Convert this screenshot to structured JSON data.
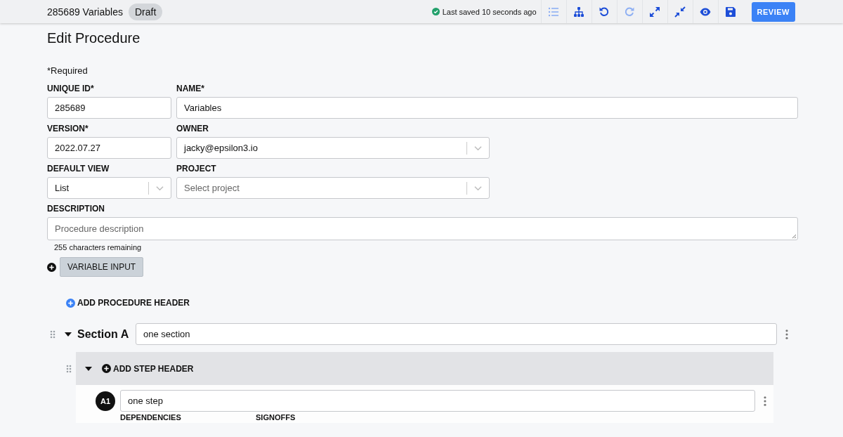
{
  "header": {
    "title": "285689 Variables",
    "status": "Draft",
    "save_status": "Last saved 10 seconds ago",
    "tools": [
      {
        "kind": "list",
        "disabled": true
      },
      {
        "kind": "tree",
        "disabled": false
      },
      {
        "kind": "undo",
        "disabled": false
      },
      {
        "kind": "redo",
        "disabled": true
      },
      {
        "kind": "expand",
        "disabled": false
      },
      {
        "kind": "collapse",
        "disabled": false
      },
      {
        "kind": "eye",
        "disabled": false
      },
      {
        "kind": "save",
        "disabled": false
      }
    ],
    "review": "REVIEW"
  },
  "page_title": "Edit Procedure",
  "required_note": "*Required",
  "fields": [
    {
      "label": "UNIQUE ID*",
      "kind": "text",
      "value": "285689"
    },
    {
      "label": "NAME*",
      "kind": "text",
      "value": "Variables"
    },
    {
      "label": "VERSION*",
      "kind": "text",
      "value": "2022.07.27"
    },
    {
      "label": "OWNER",
      "kind": "select",
      "value": "jacky@epsilon3.io"
    },
    {
      "label": "DEFAULT VIEW",
      "kind": "select",
      "value": "List"
    },
    {
      "label": "PROJECT",
      "kind": "select",
      "placeholder": "Select project"
    },
    {
      "label": "DESCRIPTION",
      "kind": "textarea",
      "placeholder": "Procedure description",
      "note": "255 characters remaining"
    }
  ],
  "variable_input": "VARIABLE INPUT",
  "add_procedure_header": "ADD PROCEDURE HEADER",
  "sections": [
    {
      "name": "Section A",
      "expanded": true,
      "value": "one section",
      "step_header": {
        "label": "ADD STEP HEADER",
        "expanded": true
      },
      "steps": [
        {
          "badge": "A1",
          "value": "one step",
          "columns": [
            "DEPENDENCIES",
            "SIGNOFFS"
          ]
        }
      ]
    }
  ]
}
